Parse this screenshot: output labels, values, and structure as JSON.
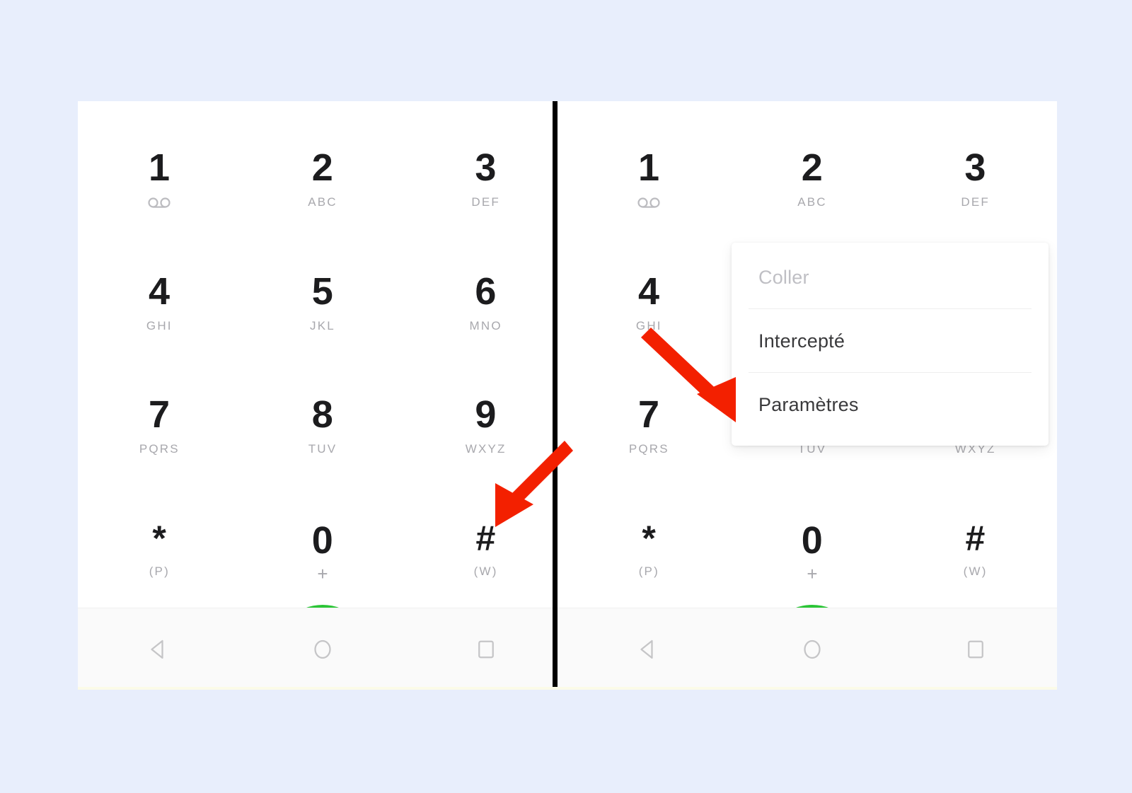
{
  "page": {
    "background_color": "#e8eefc",
    "board_background": "#ffffff",
    "divider_color": "#000000"
  },
  "colors": {
    "call_green": "#2bc536",
    "accent_blue": "#4a90e8",
    "arrow_red": "#f32000",
    "digit_dark": "#1c1c1e",
    "sub_gray": "#a8a8ad",
    "nav_gray": "#c5c5c7"
  },
  "dialpad": {
    "keys": [
      {
        "digit": "1",
        "sub": "",
        "sub_kind": "voicemail"
      },
      {
        "digit": "2",
        "sub": "ABC",
        "sub_kind": "letters"
      },
      {
        "digit": "3",
        "sub": "DEF",
        "sub_kind": "letters"
      },
      {
        "digit": "4",
        "sub": "GHI",
        "sub_kind": "letters"
      },
      {
        "digit": "5",
        "sub": "JKL",
        "sub_kind": "letters"
      },
      {
        "digit": "6",
        "sub": "MNO",
        "sub_kind": "letters"
      },
      {
        "digit": "7",
        "sub": "PQRS",
        "sub_kind": "letters"
      },
      {
        "digit": "8",
        "sub": "TUV",
        "sub_kind": "letters"
      },
      {
        "digit": "9",
        "sub": "WXYZ",
        "sub_kind": "letters"
      },
      {
        "digit": "*",
        "sub": "(P)",
        "sub_kind": "letters"
      },
      {
        "digit": "0",
        "sub": "+",
        "sub_kind": "plus"
      },
      {
        "digit": "#",
        "sub": "(W)",
        "sub_kind": "letters"
      }
    ]
  },
  "actions": {
    "keypad_icon": "keypad-icon",
    "call_icon": "phone-handset-icon",
    "overflow_icon": "more-vertical-icon"
  },
  "navbar": {
    "back": "back-triangle-icon",
    "home": "home-circle-icon",
    "recents": "recents-square-icon"
  },
  "menu": {
    "items": [
      {
        "label": "Coller",
        "disabled": true
      },
      {
        "label": "Intercepté",
        "disabled": false
      },
      {
        "label": "Paramètres",
        "disabled": false
      }
    ]
  },
  "annotations": {
    "arrows": [
      {
        "name": "arrow-to-overflow-menu",
        "direction": "down-left",
        "target": "more-vertical-icon"
      },
      {
        "name": "arrow-to-parametres-item",
        "direction": "down-right",
        "target": "Paramètres"
      }
    ]
  },
  "panels": [
    {
      "name": "step-1-dialer",
      "menu_open": false
    },
    {
      "name": "step-2-dialer-with-menu",
      "menu_open": true
    }
  ]
}
